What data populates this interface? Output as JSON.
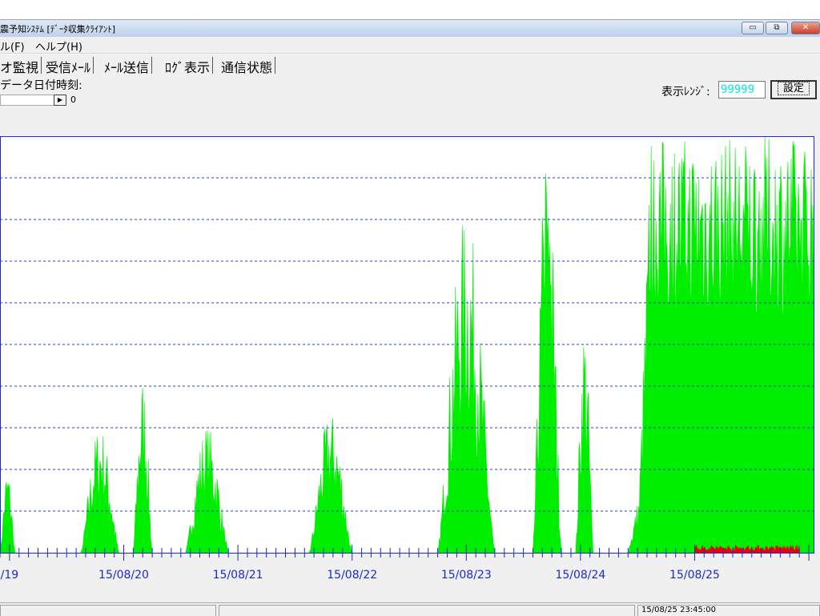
{
  "window": {
    "title": "震予知ｼｽﾃﾑ [ﾃﾞｰﾀ収集ｸﾗｲｱﾝﾄ]",
    "min_glyph": "▭",
    "max_glyph": "⧉",
    "close_glyph": "✕"
  },
  "menu": [
    {
      "label": "ル(F)"
    },
    {
      "label": "ヘルプ(H)"
    }
  ],
  "tabs": [
    {
      "label": "オ監視"
    },
    {
      "label": "受信ﾒｰﾙ"
    },
    {
      "label": "ﾒｰﾙ送信"
    },
    {
      "label": "ﾛｸﾞ表示"
    },
    {
      "label": "通信状態"
    }
  ],
  "toolbar": {
    "datetime_label": "データ日付時刻:",
    "scroll_value": "0",
    "scroll_arrow": "▶",
    "range_label": "表示ﾚﾝｼﾞ:",
    "range_value": "99999",
    "set_label": "設定"
  },
  "status": {
    "cells": [
      "",
      "",
      "15/08/25 23:45:00"
    ]
  },
  "colors": {
    "signal": "#00ee00",
    "secondary_signal": "#ee0000",
    "gridline": "#2a3ad8",
    "axis": "#1a2ad0",
    "tick_text": "#1a2ad0"
  },
  "chart_data": {
    "type": "area",
    "xlabel": "",
    "ylabel": "",
    "title": "",
    "ylim": [
      0,
      99999
    ],
    "x_range": [
      "15/08/18 22:00",
      "15/08/26 01:00"
    ],
    "x_tick_labels": [
      "/19",
      "15/08/20",
      "15/08/21",
      "15/08/22",
      "15/08/23",
      "15/08/24",
      "15/08/25"
    ],
    "y_gridlines": 9,
    "grid": "horizontal-dashed",
    "series": [
      {
        "color": "#00ee00",
        "segments": [
          {
            "start": "15/08/18 22:00",
            "end": "15/08/19 01:10",
            "peak": 21000
          },
          {
            "start": "15/08/19 15:00",
            "end": "15/08/19 23:00",
            "peak": 31000
          },
          {
            "start": "15/08/20 02:00",
            "end": "15/08/20 06:00",
            "peak": 43000
          },
          {
            "start": "15/08/20 13:00",
            "end": "15/08/20 22:00",
            "peak": 31000
          },
          {
            "start": "15/08/21 15:00",
            "end": "15/08/22 00:00",
            "peak": 34000
          },
          {
            "start": "15/08/22 18:00",
            "end": "15/08/23 06:00",
            "peak": 82000
          },
          {
            "start": "15/08/23 14:00",
            "end": "15/08/23 20:00",
            "peak": 99999
          },
          {
            "start": "15/08/23 23:00",
            "end": "15/08/24 02:40",
            "peak": 57000
          },
          {
            "start": "15/08/24 10:00",
            "end": "15/08/26 01:00",
            "peak": 99999
          }
        ]
      },
      {
        "color": "#ee0000",
        "segments": [
          {
            "start": "15/08/25 00:00",
            "end": "15/08/25 22:00",
            "peak": 1800
          }
        ]
      }
    ]
  }
}
